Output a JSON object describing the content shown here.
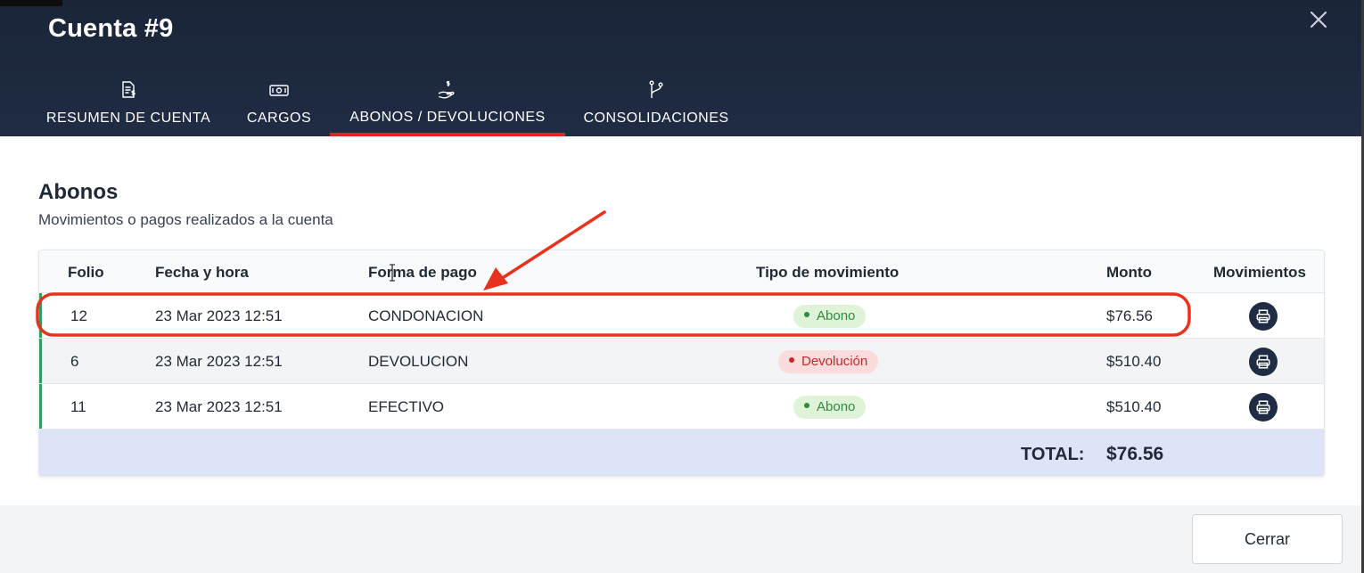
{
  "modal": {
    "title": "Cuenta #9",
    "tabs": [
      {
        "label": "RESUMEN DE CUENTA",
        "icon": "invoice-dollar-icon"
      },
      {
        "label": "CARGOS",
        "icon": "banknote-icon"
      },
      {
        "label": "ABONOS / DEVOLUCIONES",
        "icon": "hand-dollar-icon",
        "active": true
      },
      {
        "label": "CONSOLIDACIONES",
        "icon": "merge-branch-icon"
      }
    ]
  },
  "section": {
    "title": "Abonos",
    "subtitle": "Movimientos o pagos realizados a la cuenta"
  },
  "table": {
    "headers": [
      "Folio",
      "Fecha y hora",
      "Forma de pago",
      "Tipo de movimiento",
      "Monto",
      "Movimientos"
    ],
    "rows": [
      {
        "folio": "12",
        "fecha": "23 Mar 2023 12:51",
        "forma": "CONDONACION",
        "tipo": "Abono",
        "monto": "$76.56"
      },
      {
        "folio": "6",
        "fecha": "23 Mar 2023 12:51",
        "forma": "DEVOLUCION",
        "tipo": "Devolución",
        "monto": "$510.40"
      },
      {
        "folio": "11",
        "fecha": "23 Mar 2023 12:51",
        "forma": "EFECTIVO",
        "tipo": "Abono",
        "monto": "$510.40"
      }
    ],
    "total_label": "TOTAL:",
    "total_value": "$76.56"
  },
  "footer": {
    "close_label": "Cerrar"
  },
  "colors": {
    "header_bg": "#1f2c44",
    "active_tab_indicator": "#e02424",
    "abono_badge": "#dff3d8",
    "devolucion_badge": "#fbdcdc",
    "total_row_bg": "#dde4f8",
    "annotation_red": "#e8321e"
  }
}
